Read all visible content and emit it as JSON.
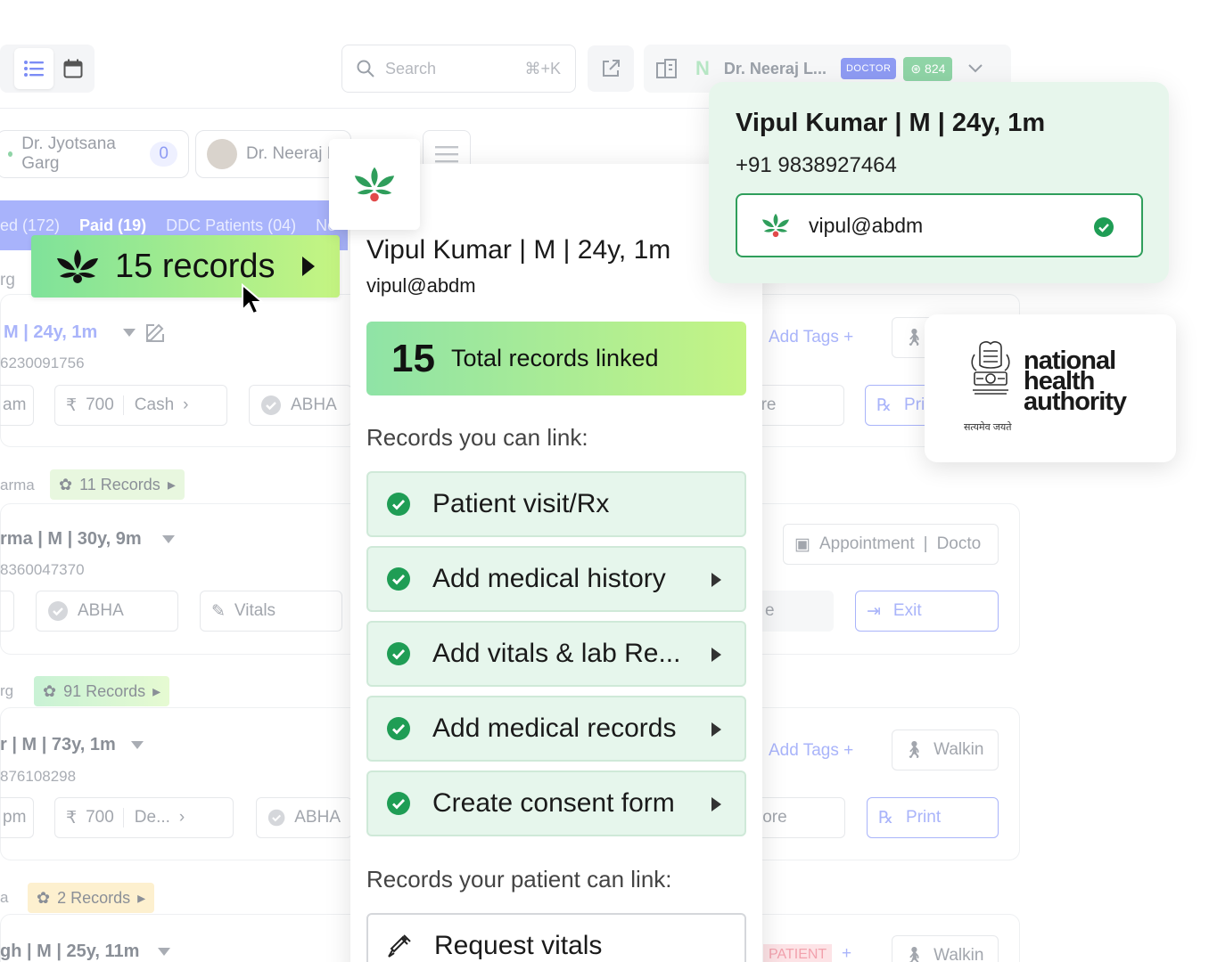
{
  "topbar": {
    "search_placeholder": "Search",
    "search_shortcut": "⌘+K",
    "user_initial": "N",
    "user_name": "Dr. Neeraj L...",
    "role_badge": "DOCTOR",
    "points": "824"
  },
  "doctor_tabs": [
    {
      "name": "Dr. Jyotsana Garg",
      "count": "0"
    },
    {
      "name": "Dr. Neeraj L"
    }
  ],
  "filters": [
    "ed (172)",
    "Paid (19)",
    "DDC Patients (04)",
    "Ne"
  ],
  "background_rows": {
    "row1": {
      "tag_prefix": "rg",
      "name": "M | 24y, 1m",
      "phone": "6230091756",
      "pill_am": "am",
      "amount": "700",
      "payment": "Cash",
      "abha": "ABHA",
      "add_tags": "Add Tags",
      "more": "ore",
      "print": "Pri"
    },
    "row2": {
      "tag_prefix": "arma",
      "records": "11 Records",
      "name": "rma | M | 30y, 9m",
      "phone": "8360047370",
      "abha": "ABHA",
      "vitals": "Vitals",
      "appointment": "Appointment",
      "docto": "Docto",
      "exit": "Exit",
      "e": "e"
    },
    "row3": {
      "tag_prefix": "rg",
      "records": "91 Records",
      "name": "r | M | 73y, 1m",
      "phone": "876108298",
      "pill_pm": "pm",
      "amount": "700",
      "payment": "De...",
      "abha": "ABHA",
      "add_tags": "Add Tags",
      "walkin": "Walkin",
      "more": "lore",
      "print": "Print"
    },
    "row4": {
      "tag_prefix": "a",
      "records": "2 Records",
      "name": "gh | M | 25y, 11m",
      "patient_badge": "PATIENT",
      "walkin": "Walkin"
    }
  },
  "records_chip": {
    "label": "15 records"
  },
  "panel": {
    "name": "Vipul Kumar | M | 24y, 1m",
    "abha": "vipul@abdm",
    "total_count": "15",
    "total_label": "Total records linked",
    "section_you": "Records you can link:",
    "items": [
      "Patient visit/Rx",
      "Add medical history",
      "Add vitals & lab Re...",
      "Add medical records",
      "Create consent form"
    ],
    "section_patient": "Records your patient can link:",
    "request_item": "Request vitals"
  },
  "patient_card": {
    "name": "Vipul Kumar | M | 24y, 1m",
    "phone": "+91 9838927464",
    "abha": "vipul@abdm"
  },
  "nha": {
    "line1": "national",
    "line2": "health",
    "line3": "authority",
    "motto": "सत्यमेव जयते"
  },
  "colors": {
    "brand_green": "#2f9e5b",
    "accent_indigo": "#8e9bf3",
    "panel_item_bg": "#e6f6ec"
  }
}
